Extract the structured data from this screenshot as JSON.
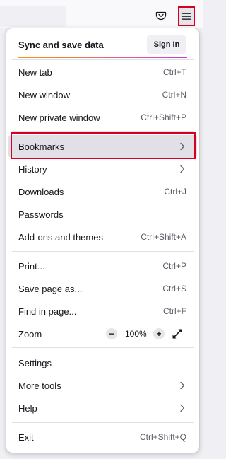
{
  "toolbar": {
    "pocket_icon": "pocket-icon",
    "menu_icon": "hamburger-menu-icon"
  },
  "menu": {
    "sync": {
      "label": "Sync and save data",
      "sign_in": "Sign In"
    },
    "new_tab": {
      "label": "New tab",
      "shortcut": "Ctrl+T"
    },
    "new_window": {
      "label": "New window",
      "shortcut": "Ctrl+N"
    },
    "new_private_window": {
      "label": "New private window",
      "shortcut": "Ctrl+Shift+P"
    },
    "bookmarks": {
      "label": "Bookmarks"
    },
    "history": {
      "label": "History"
    },
    "downloads": {
      "label": "Downloads",
      "shortcut": "Ctrl+J"
    },
    "passwords": {
      "label": "Passwords"
    },
    "addons": {
      "label": "Add-ons and themes",
      "shortcut": "Ctrl+Shift+A"
    },
    "print": {
      "label": "Print...",
      "shortcut": "Ctrl+P"
    },
    "save_page": {
      "label": "Save page as...",
      "shortcut": "Ctrl+S"
    },
    "find": {
      "label": "Find in page...",
      "shortcut": "Ctrl+F"
    },
    "zoom": {
      "label": "Zoom",
      "minus": "−",
      "level": "100%",
      "plus": "+"
    },
    "settings": {
      "label": "Settings"
    },
    "more_tools": {
      "label": "More tools"
    },
    "help": {
      "label": "Help"
    },
    "exit": {
      "label": "Exit",
      "shortcut": "Ctrl+Shift+Q"
    }
  },
  "colors": {
    "highlight_border": "#d70022",
    "accent_start": "#ff9500",
    "accent_end": "#c93bd9"
  }
}
